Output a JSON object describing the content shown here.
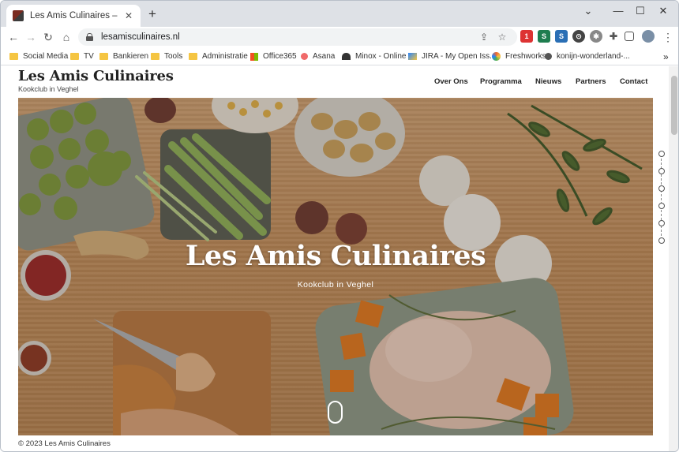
{
  "tab": {
    "title": "Les Amis Culinaires – Kookclub",
    "close": "✕",
    "new_tab": "+"
  },
  "window": {
    "minimize": "⌄",
    "min": "—",
    "max": "☐",
    "close": "✕"
  },
  "toolbar": {
    "back": "←",
    "forward": "→",
    "reload": "↻",
    "home": "⌂",
    "url": "lesamisculinaires.nl",
    "share": "⇪",
    "star": "☆",
    "menu": "⋮"
  },
  "bookmarks": [
    {
      "label": "Social Media"
    },
    {
      "label": "TV"
    },
    {
      "label": "Bankieren"
    },
    {
      "label": "Tools"
    },
    {
      "label": "Administratie"
    },
    {
      "label": "Office365"
    },
    {
      "label": "Asana"
    },
    {
      "label": "Minox - Online"
    },
    {
      "label": "JIRA - My Open Iss..."
    },
    {
      "label": "Freshworks"
    },
    {
      "label": "konijn-wonderland-..."
    }
  ],
  "bookmarks_more": "»",
  "site": {
    "title": "Les Amis Culinaires",
    "subtitle": "Kookclub in Veghel",
    "nav": [
      "Over Ons",
      "Programma",
      "Nieuws",
      "Partners",
      "Contact"
    ]
  },
  "hero": {
    "title": "Les Amis Culinaires",
    "subtitle": "Kookclub in Veghel"
  },
  "footer": "© 2023 Les Amis Culinaires",
  "colors": {
    "accent_folder": "#f5c542",
    "tabstrip": "#dee1e6",
    "wood": "#c69462"
  }
}
